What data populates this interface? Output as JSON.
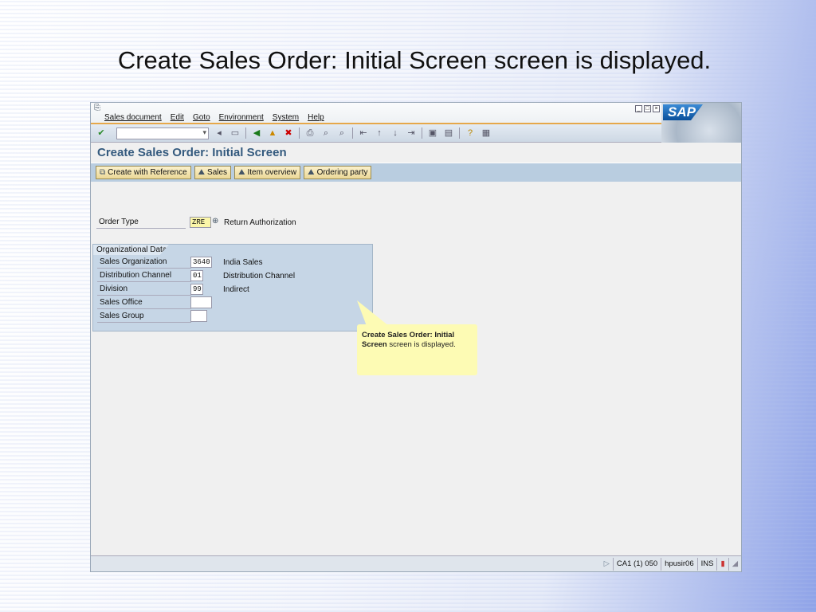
{
  "slide_title": "Create Sales Order: Initial Screen screen is displayed.",
  "menu": [
    "Sales document",
    "Edit",
    "Goto",
    "Environment",
    "System",
    "Help"
  ],
  "logo_text": "SAP",
  "screen_title": "Create Sales Order: Initial Screen",
  "app_buttons": [
    "Create with Reference",
    "Sales",
    "Item overview",
    "Ordering party"
  ],
  "order_type": {
    "label": "Order Type",
    "value": "ZRE",
    "description": "Return Authorization"
  },
  "org": {
    "title": "Organizational Data",
    "fields": [
      {
        "label": "Sales Organization",
        "value": "3640",
        "description": "India Sales"
      },
      {
        "label": "Distribution Channel",
        "value": "01",
        "description": "Distribution Channel"
      },
      {
        "label": "Division",
        "value": "99",
        "description": "Indirect"
      },
      {
        "label": "Sales Office",
        "value": "",
        "description": ""
      },
      {
        "label": "Sales Group",
        "value": "",
        "description": ""
      }
    ]
  },
  "callout": {
    "bold": "Create Sales Order: Initial Screen",
    "rest": " screen is displayed."
  },
  "status": {
    "system": "CA1 (1) 050",
    "server": "hpusir06",
    "mode": "INS"
  }
}
